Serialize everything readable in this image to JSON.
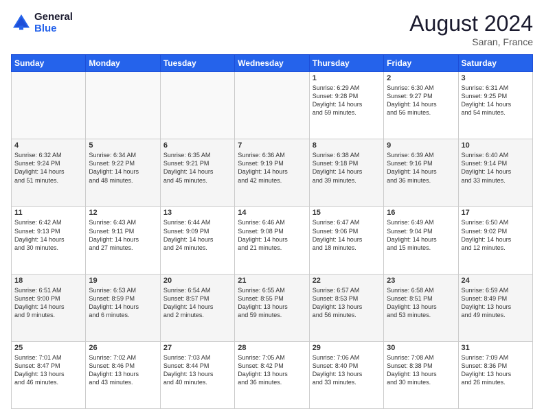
{
  "logo": {
    "line1": "General",
    "line2": "Blue"
  },
  "title": "August 2024",
  "location": "Saran, France",
  "days_header": [
    "Sunday",
    "Monday",
    "Tuesday",
    "Wednesday",
    "Thursday",
    "Friday",
    "Saturday"
  ],
  "weeks": [
    [
      {
        "day": "",
        "info": ""
      },
      {
        "day": "",
        "info": ""
      },
      {
        "day": "",
        "info": ""
      },
      {
        "day": "",
        "info": ""
      },
      {
        "day": "1",
        "info": "Sunrise: 6:29 AM\nSunset: 9:28 PM\nDaylight: 14 hours\nand 59 minutes."
      },
      {
        "day": "2",
        "info": "Sunrise: 6:30 AM\nSunset: 9:27 PM\nDaylight: 14 hours\nand 56 minutes."
      },
      {
        "day": "3",
        "info": "Sunrise: 6:31 AM\nSunset: 9:25 PM\nDaylight: 14 hours\nand 54 minutes."
      }
    ],
    [
      {
        "day": "4",
        "info": "Sunrise: 6:32 AM\nSunset: 9:24 PM\nDaylight: 14 hours\nand 51 minutes."
      },
      {
        "day": "5",
        "info": "Sunrise: 6:34 AM\nSunset: 9:22 PM\nDaylight: 14 hours\nand 48 minutes."
      },
      {
        "day": "6",
        "info": "Sunrise: 6:35 AM\nSunset: 9:21 PM\nDaylight: 14 hours\nand 45 minutes."
      },
      {
        "day": "7",
        "info": "Sunrise: 6:36 AM\nSunset: 9:19 PM\nDaylight: 14 hours\nand 42 minutes."
      },
      {
        "day": "8",
        "info": "Sunrise: 6:38 AM\nSunset: 9:18 PM\nDaylight: 14 hours\nand 39 minutes."
      },
      {
        "day": "9",
        "info": "Sunrise: 6:39 AM\nSunset: 9:16 PM\nDaylight: 14 hours\nand 36 minutes."
      },
      {
        "day": "10",
        "info": "Sunrise: 6:40 AM\nSunset: 9:14 PM\nDaylight: 14 hours\nand 33 minutes."
      }
    ],
    [
      {
        "day": "11",
        "info": "Sunrise: 6:42 AM\nSunset: 9:13 PM\nDaylight: 14 hours\nand 30 minutes."
      },
      {
        "day": "12",
        "info": "Sunrise: 6:43 AM\nSunset: 9:11 PM\nDaylight: 14 hours\nand 27 minutes."
      },
      {
        "day": "13",
        "info": "Sunrise: 6:44 AM\nSunset: 9:09 PM\nDaylight: 14 hours\nand 24 minutes."
      },
      {
        "day": "14",
        "info": "Sunrise: 6:46 AM\nSunset: 9:08 PM\nDaylight: 14 hours\nand 21 minutes."
      },
      {
        "day": "15",
        "info": "Sunrise: 6:47 AM\nSunset: 9:06 PM\nDaylight: 14 hours\nand 18 minutes."
      },
      {
        "day": "16",
        "info": "Sunrise: 6:49 AM\nSunset: 9:04 PM\nDaylight: 14 hours\nand 15 minutes."
      },
      {
        "day": "17",
        "info": "Sunrise: 6:50 AM\nSunset: 9:02 PM\nDaylight: 14 hours\nand 12 minutes."
      }
    ],
    [
      {
        "day": "18",
        "info": "Sunrise: 6:51 AM\nSunset: 9:00 PM\nDaylight: 14 hours\nand 9 minutes."
      },
      {
        "day": "19",
        "info": "Sunrise: 6:53 AM\nSunset: 8:59 PM\nDaylight: 14 hours\nand 6 minutes."
      },
      {
        "day": "20",
        "info": "Sunrise: 6:54 AM\nSunset: 8:57 PM\nDaylight: 14 hours\nand 2 minutes."
      },
      {
        "day": "21",
        "info": "Sunrise: 6:55 AM\nSunset: 8:55 PM\nDaylight: 13 hours\nand 59 minutes."
      },
      {
        "day": "22",
        "info": "Sunrise: 6:57 AM\nSunset: 8:53 PM\nDaylight: 13 hours\nand 56 minutes."
      },
      {
        "day": "23",
        "info": "Sunrise: 6:58 AM\nSunset: 8:51 PM\nDaylight: 13 hours\nand 53 minutes."
      },
      {
        "day": "24",
        "info": "Sunrise: 6:59 AM\nSunset: 8:49 PM\nDaylight: 13 hours\nand 49 minutes."
      }
    ],
    [
      {
        "day": "25",
        "info": "Sunrise: 7:01 AM\nSunset: 8:47 PM\nDaylight: 13 hours\nand 46 minutes."
      },
      {
        "day": "26",
        "info": "Sunrise: 7:02 AM\nSunset: 8:46 PM\nDaylight: 13 hours\nand 43 minutes."
      },
      {
        "day": "27",
        "info": "Sunrise: 7:03 AM\nSunset: 8:44 PM\nDaylight: 13 hours\nand 40 minutes."
      },
      {
        "day": "28",
        "info": "Sunrise: 7:05 AM\nSunset: 8:42 PM\nDaylight: 13 hours\nand 36 minutes."
      },
      {
        "day": "29",
        "info": "Sunrise: 7:06 AM\nSunset: 8:40 PM\nDaylight: 13 hours\nand 33 minutes."
      },
      {
        "day": "30",
        "info": "Sunrise: 7:08 AM\nSunset: 8:38 PM\nDaylight: 13 hours\nand 30 minutes."
      },
      {
        "day": "31",
        "info": "Sunrise: 7:09 AM\nSunset: 8:36 PM\nDaylight: 13 hours\nand 26 minutes."
      }
    ]
  ]
}
